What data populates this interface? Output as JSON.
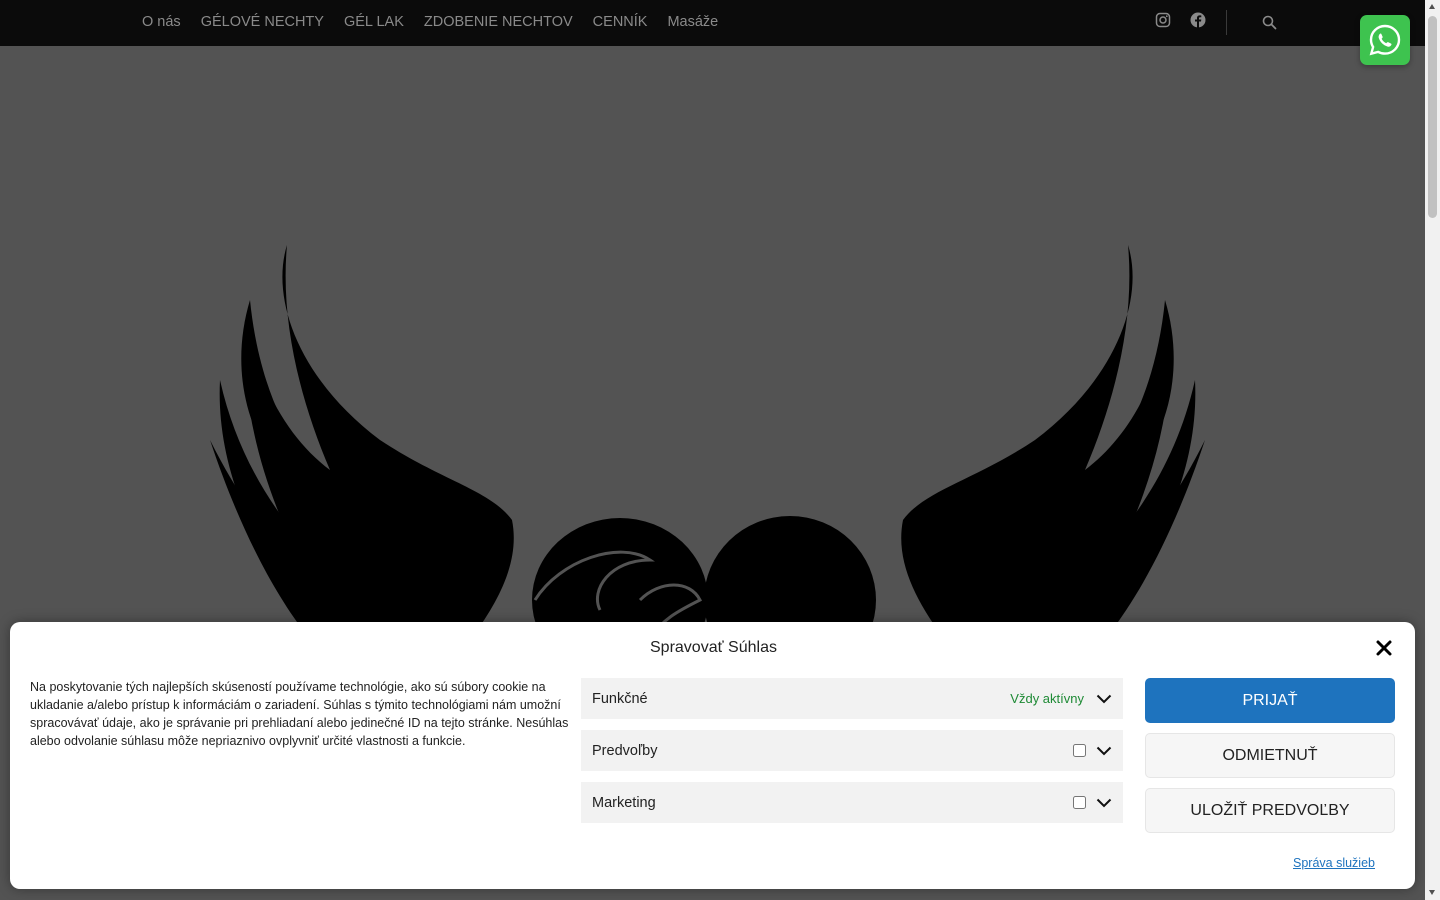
{
  "nav": {
    "items": [
      "O nás",
      "GÉLOVÉ NECHTY",
      "GÉL LAK",
      "ZDOBENIE NECHTOV",
      "CENNÍK",
      "Masáže"
    ],
    "social": [
      "instagram-icon",
      "facebook-icon"
    ],
    "search_icon": "search-icon"
  },
  "whatsapp": {
    "icon": "whatsapp-icon",
    "color": "#3ec34f"
  },
  "consent": {
    "title": "Spravovať Súhlas",
    "text": "Na poskytovanie tých najlepších skúseností používame technológie, ako sú súbory cookie na ukladanie a/alebo prístup k informáciám o zariadení. Súhlas s týmito technológiami nám umožní spracovávať údaje, ako je správanie pri prehliadaní alebo jedinečné ID na tejto stránke. Nesúhlas alebo odvolanie súhlasu môže nepriaznivo ovplyvniť určité vlastnosti a funkcie.",
    "categories": [
      {
        "label": "Funkčné",
        "status": "Vždy aktívny"
      },
      {
        "label": "Predvoľby",
        "checked": false
      },
      {
        "label": "Marketing",
        "checked": false
      }
    ],
    "accept_label": "PRIJAŤ",
    "deny_label": "ODMIETNUŤ",
    "save_label": "ULOŽIŤ PREDVOĽBY",
    "manage_link": "Správa služieb",
    "accent_color": "#1e73be",
    "always_active_color": "#1e8a35"
  }
}
